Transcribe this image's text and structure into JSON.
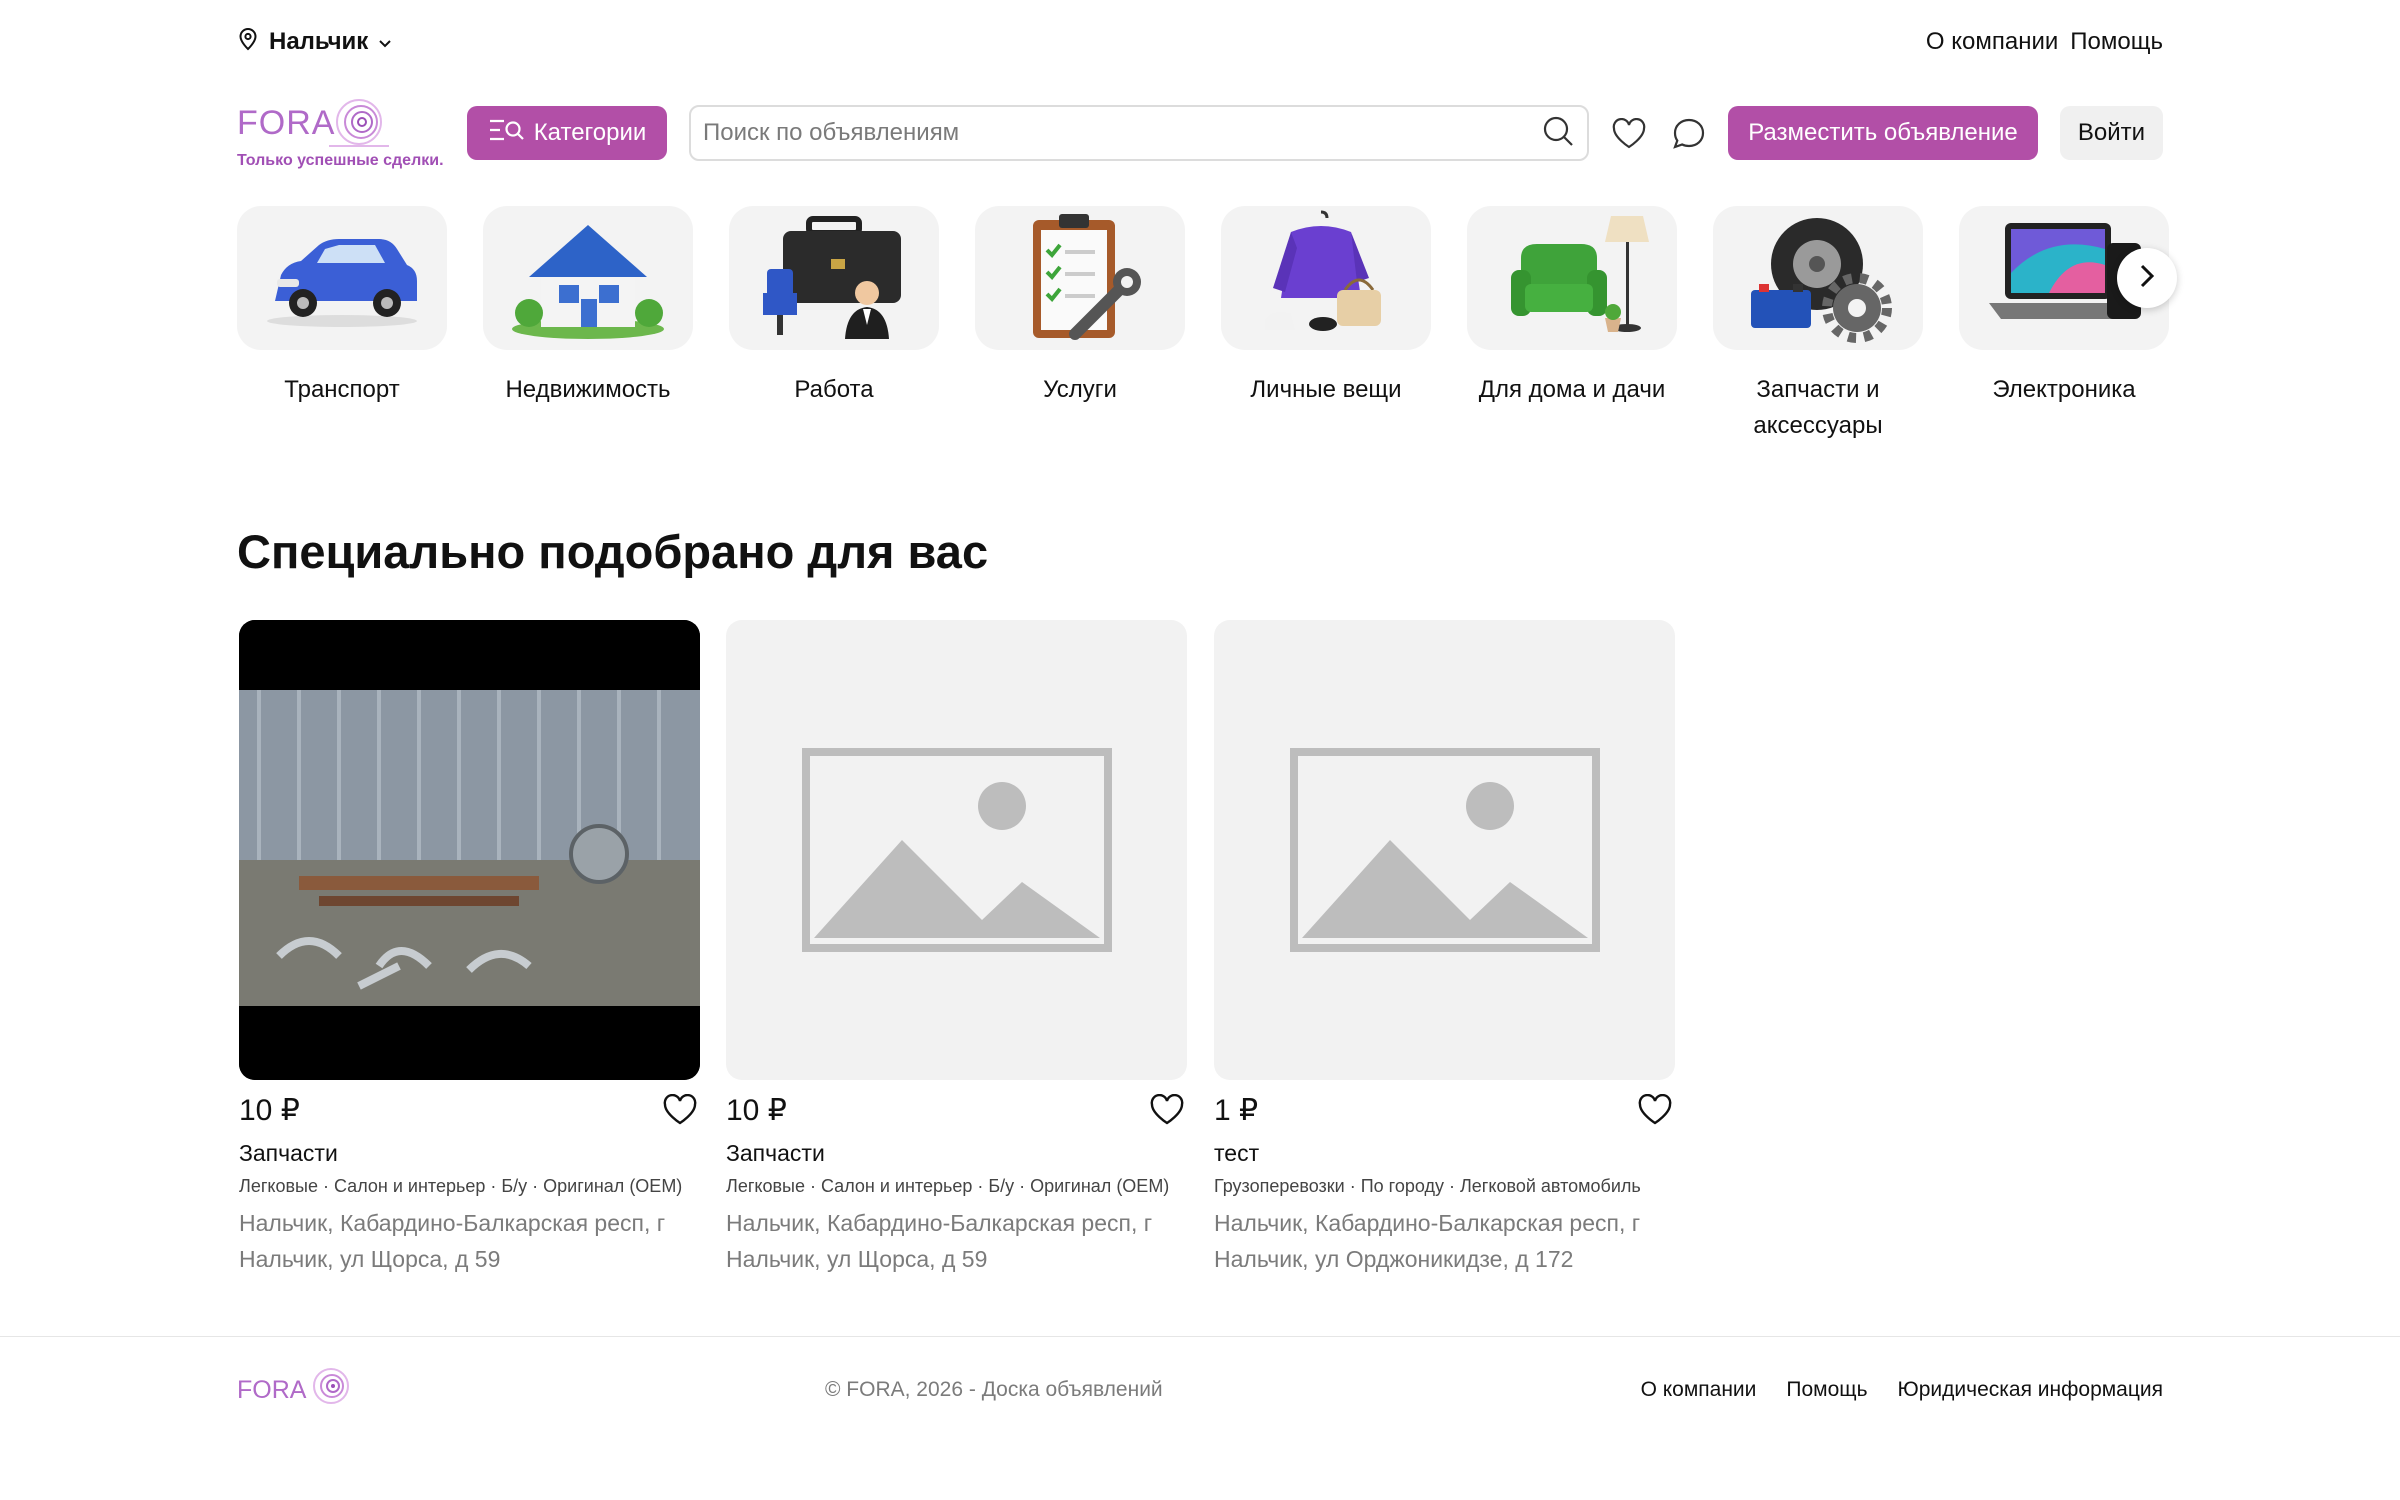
{
  "topbar": {
    "city": "Нальчик",
    "links": [
      "О компании",
      "Помощь"
    ]
  },
  "header": {
    "logo_text": "FORA",
    "tagline": "Только успешные сделки.",
    "categories_button": "Категории",
    "search_placeholder": "Поиск по объявлениям",
    "post_button": "Разместить объявление",
    "login_button": "Войти"
  },
  "categories": [
    {
      "label": "Транспорт",
      "icon": "car-icon"
    },
    {
      "label": "Недвижимость",
      "icon": "house-icon"
    },
    {
      "label": "Работа",
      "icon": "briefcase-icon"
    },
    {
      "label": "Услуги",
      "icon": "clipboard-wrench-icon"
    },
    {
      "label": "Личные вещи",
      "icon": "clothes-icon"
    },
    {
      "label": "Для дома и дачи",
      "icon": "armchair-icon"
    },
    {
      "label": "Запчасти и аксессуары",
      "icon": "tire-gear-icon"
    },
    {
      "label": "Электроника",
      "icon": "laptop-icon"
    }
  ],
  "section": {
    "title": "Специально подобрано для вас"
  },
  "listings": [
    {
      "price": "10 ₽",
      "title": "Запчасти",
      "tags": "Легковые · Салон и интерьер · Б/у · Оригинал (OEM)",
      "address": "Нальчик, Кабардино-Балкарская респ, г Нальчик, ул Щорса, д 59",
      "has_photo": true
    },
    {
      "price": "10 ₽",
      "title": "Запчасти",
      "tags": "Легковые · Салон и интерьер · Б/у · Оригинал (OEM)",
      "address": "Нальчик, Кабардино-Балкарская респ, г Нальчик, ул Щорса, д 59",
      "has_photo": false
    },
    {
      "price": "1 ₽",
      "title": "тест",
      "tags": "Грузоперевозки · По городу · Легковой автомобиль",
      "address": "Нальчик, Кабардино-Балкарская респ, г Нальчик, ул Орджоникидзе, д 172",
      "has_photo": false
    }
  ],
  "footer": {
    "logo_text": "FORA",
    "copyright": "© FORA, 2026 - Доска объявлений",
    "links": [
      "О компании",
      "Помощь",
      "Юридическая информация"
    ]
  },
  "colors": {
    "accent": "#b24fa7",
    "logo": "#b06ac8"
  }
}
